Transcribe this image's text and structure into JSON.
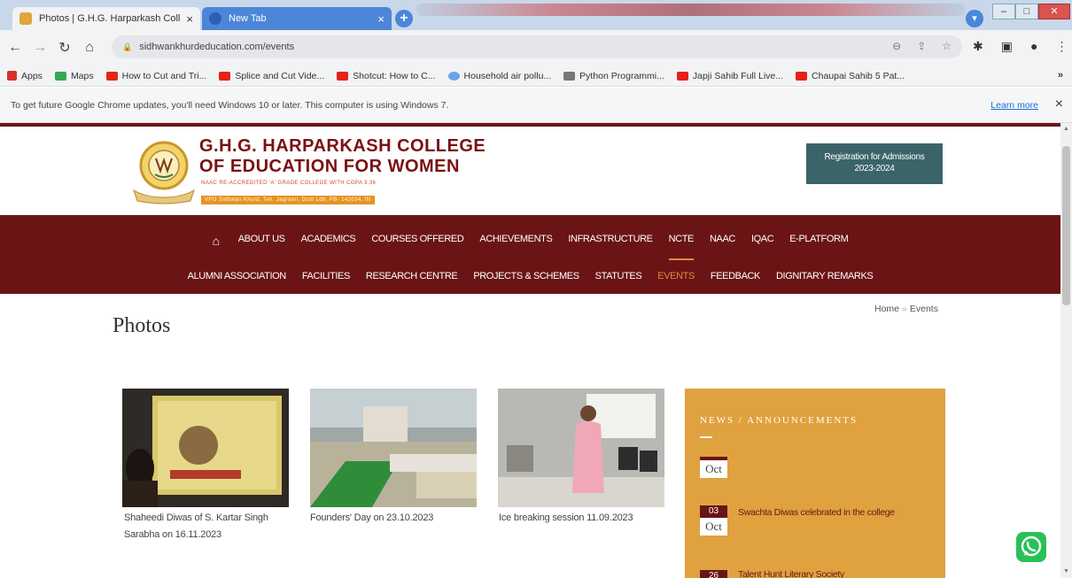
{
  "browser": {
    "tabs": [
      {
        "title": "Photos | G.H.G. Harparkash Colle",
        "close": "×"
      },
      {
        "title": "New Tab",
        "close": "×"
      }
    ],
    "new_tab": "+",
    "url": "sidhwankhurdeducation.com/events",
    "bookmarks": [
      {
        "label": "Apps",
        "color": "#d9312a"
      },
      {
        "label": "Maps",
        "color": "#34a853"
      },
      {
        "label": "How to Cut and Tri...",
        "color": "#e62117"
      },
      {
        "label": "Splice and Cut Vide...",
        "color": "#e62117"
      },
      {
        "label": "Shotcut: How to C...",
        "color": "#e62117"
      },
      {
        "label": "Household air pollu...",
        "color": "#6aa4e8"
      },
      {
        "label": "Python Programmi...",
        "color": "#777777"
      },
      {
        "label": "Japji Sahib Full Live...",
        "color": "#e62117"
      },
      {
        "label": "Chaupai Sahib 5 Pat...",
        "color": "#e62117"
      }
    ],
    "bookmarks_more": "»",
    "infobar": {
      "message": "To get future Google Chrome updates, you'll need Windows 10 or later. This computer is using Windows 7.",
      "learn_more": "Learn more",
      "close": "×"
    }
  },
  "site": {
    "college_name_1": "G.H.G. HARPARKASH COLLEGE",
    "college_name_2": "OF EDUCATION FOR WOMEN",
    "accreditation": "NAAC RE-ACCREDITED 'A' GRADE COLLEGE WITH CGPA 3.36",
    "address": "VPO Sidhwan Khurd, Teh. Jagraon, Distt Ldh, PB- 142034, IN",
    "registration": {
      "line1": "Registration for Admissions",
      "line2": "2023-2024"
    },
    "nav_row1": [
      "ABOUT US",
      "ACADEMICS",
      "COURSES OFFERED",
      "ACHIEVEMENTS",
      "INFRASTRUCTURE",
      "NCTE",
      "NAAC",
      "IQAC",
      "E-PLATFORM"
    ],
    "nav_row2": [
      "ALUMNI ASSOCIATION",
      "FACILITIES",
      "RESEARCH CENTRE",
      "PROJECTS & SCHEMES",
      "STATUTES",
      "EVENTS",
      "FEEDBACK",
      "DIGNITARY REMARKS"
    ],
    "page_title": "Photos",
    "breadcrumb": {
      "home": "Home",
      "sep": "»",
      "current": "Events"
    },
    "photos": [
      {
        "caption_1": "Shaheedi Diwas of S. Kartar Singh",
        "caption_2": "Sarabha on 16.11.2023"
      },
      {
        "caption_1": "Founders' Day on 23.10.2023",
        "caption_2": ""
      },
      {
        "caption_1": "Ice breaking session 11.09.2023",
        "caption_2": ""
      }
    ],
    "news": {
      "heading": "NEWS / ANNOUNCEMENTS",
      "items": [
        {
          "day": "",
          "month": "Oct",
          "text": ""
        },
        {
          "day": "03",
          "month": "Oct",
          "text": "Swachta Diwas celebrated in the college"
        },
        {
          "day": "26",
          "month": "",
          "text": "Talent Hunt Literary Society"
        }
      ]
    }
  }
}
